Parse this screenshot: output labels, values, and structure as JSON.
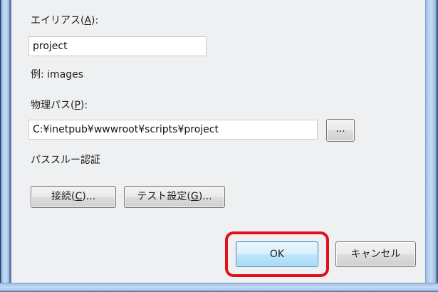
{
  "alias": {
    "label_pre": "エイリアス(",
    "label_key": "A",
    "label_post": "):",
    "value": "project",
    "example": "例: images"
  },
  "physical_path": {
    "label_pre": "物理パス(",
    "label_key": "P",
    "label_post": "):",
    "value": "C:¥inetpub¥wwwroot¥scripts¥project",
    "browse_label": "..."
  },
  "passthrough": {
    "label": "パススルー認証",
    "connect_pre": "接続(",
    "connect_key": "C",
    "connect_post": ")...",
    "test_pre": "テスト設定(",
    "test_key": "G",
    "test_post": ")..."
  },
  "footer": {
    "ok_label": "OK",
    "cancel_label": "キャンセル"
  },
  "colors": {
    "highlight": "#e0101a",
    "dialog_background": "#eef0f2",
    "ok_button": "#bee6fd"
  }
}
